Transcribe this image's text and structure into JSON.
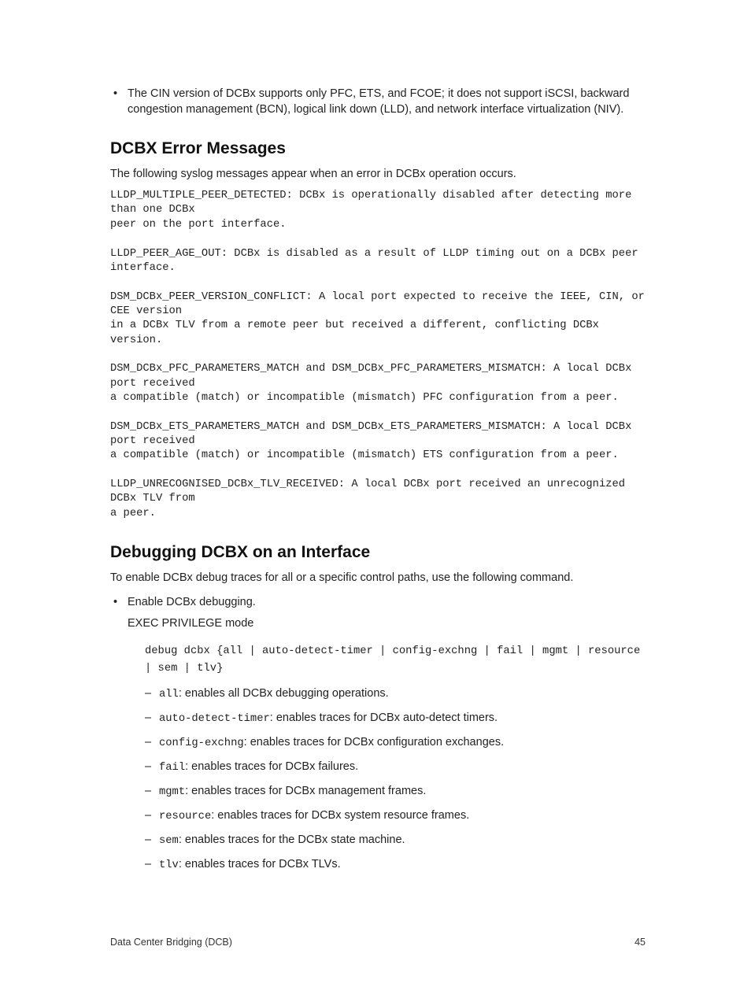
{
  "intro_bullet": "The CIN version of DCBx supports only PFC, ETS, and FCOE; it does not support iSCSI, backward congestion management (BCN), logical link down (LLD), and network interface virtualization (NIV).",
  "section1": {
    "title": "DCBX Error Messages",
    "lead": "The following syslog messages appear when an error in DCBx operation occurs.",
    "logs": "LLDP_MULTIPLE_PEER_DETECTED: DCBx is operationally disabled after detecting more than one DCBx\npeer on the port interface.\n\nLLDP_PEER_AGE_OUT: DCBx is disabled as a result of LLDP timing out on a DCBx peer interface.\n\nDSM_DCBx_PEER_VERSION_CONFLICT: A local port expected to receive the IEEE, CIN, or CEE version\nin a DCBx TLV from a remote peer but received a different, conflicting DCBx version.\n\nDSM_DCBx_PFC_PARAMETERS_MATCH and DSM_DCBx_PFC_PARAMETERS_MISMATCH: A local DCBx port received\na compatible (match) or incompatible (mismatch) PFC configuration from a peer.\n\nDSM_DCBx_ETS_PARAMETERS_MATCH and DSM_DCBx_ETS_PARAMETERS_MISMATCH: A local DCBx port received\na compatible (match) or incompatible (mismatch) ETS configuration from a peer.\n\nLLDP_UNRECOGNISED_DCBx_TLV_RECEIVED: A local DCBx port received an unrecognized DCBx TLV from\na peer."
  },
  "section2": {
    "title": "Debugging DCBX on an Interface",
    "lead": "To enable DCBx debug traces for all or a specific control paths, use the following command.",
    "step_label": "Enable DCBx debugging.",
    "mode": "EXEC PRIVILEGE mode",
    "cmd": "debug dcbx {all | auto-detect-timer | config-exchng | fail | mgmt | resource | sem | tlv}",
    "options": [
      {
        "opt": "all",
        "desc": ": enables all DCBx debugging operations."
      },
      {
        "opt": "auto-detect-timer",
        "desc": ": enables traces for DCBx auto-detect timers."
      },
      {
        "opt": "config-exchng",
        "desc": ": enables traces for DCBx configuration exchanges."
      },
      {
        "opt": "fail",
        "desc": ": enables traces for DCBx failures."
      },
      {
        "opt": "mgmt",
        "desc": ": enables traces for DCBx management frames."
      },
      {
        "opt": "resource",
        "desc": ": enables traces for DCBx system resource frames."
      },
      {
        "opt": "sem",
        "desc": ": enables traces for the DCBx state machine."
      },
      {
        "opt": "tlv",
        "desc": ": enables traces for DCBx TLVs."
      }
    ]
  },
  "footer": {
    "left": "Data Center Bridging (DCB)",
    "right": "45"
  }
}
